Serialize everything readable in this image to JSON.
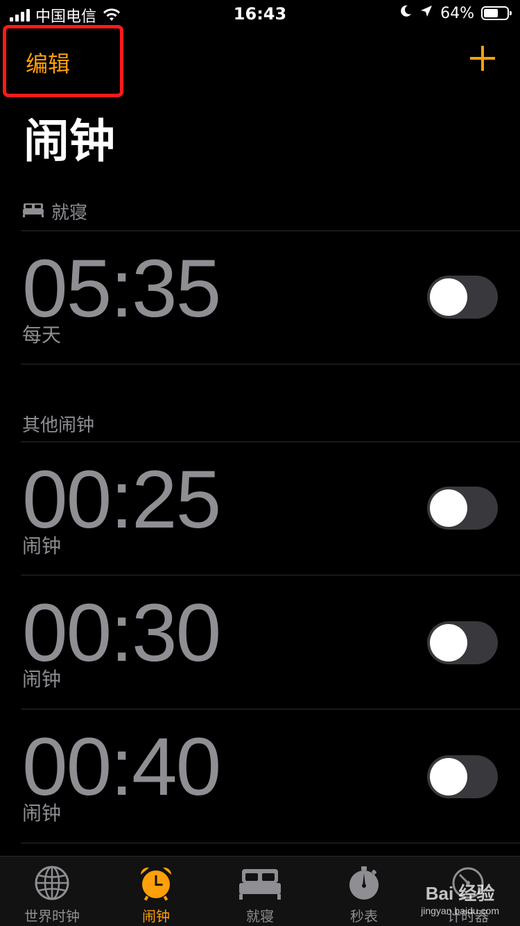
{
  "status_bar": {
    "carrier": "中国电信",
    "time": "16:43",
    "battery_text": "64%",
    "battery_level": 0.64
  },
  "nav": {
    "edit_label": "编辑",
    "add_icon": "plus-icon"
  },
  "page_title": "闹钟",
  "sections": {
    "bedtime": {
      "header": "就寝",
      "alarm": {
        "time": "05:35",
        "label": "每天",
        "enabled": false
      }
    },
    "other": {
      "header": "其他闹钟",
      "alarms": [
        {
          "time": "00:25",
          "label": "闹钟",
          "enabled": false
        },
        {
          "time": "00:30",
          "label": "闹钟",
          "enabled": false
        },
        {
          "time": "00:40",
          "label": "闹钟",
          "enabled": false
        }
      ]
    }
  },
  "tabs": [
    {
      "label": "世界时钟",
      "icon": "globe-icon"
    },
    {
      "label": "闹钟",
      "icon": "alarm-clock-icon",
      "active": true
    },
    {
      "label": "就寝",
      "icon": "bed-icon"
    },
    {
      "label": "秒表",
      "icon": "stopwatch-icon"
    },
    {
      "label": "计时器",
      "icon": "timer-icon"
    }
  ],
  "watermark": {
    "logo_text": "Bai 经验",
    "url": "jingyan.baidu.com"
  },
  "colors": {
    "accent": "#ff9f0a",
    "highlight_box": "#ff1a1a",
    "secondary_text": "#8e8e93",
    "background": "#000000"
  }
}
